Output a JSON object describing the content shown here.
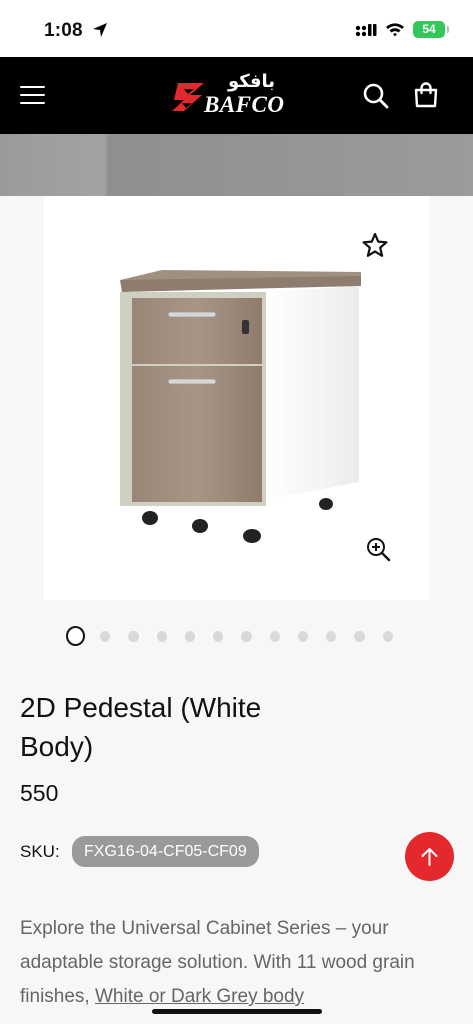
{
  "status": {
    "time": "1:08",
    "battery": "54"
  },
  "header": {
    "logo_arabic": "بافكو",
    "logo_text": "BAFCO"
  },
  "product": {
    "title": "2D Pedestal (White Body)",
    "price": "550",
    "sku_label": "SKU:",
    "sku_value": "FXG16-04-CF05-CF09",
    "image_count": 12,
    "active_image": 1
  },
  "description": {
    "text_before": "Explore the Universal Cabinet Series – your adaptable storage solution. With 11 wood grain finishes, ",
    "underlined": "White or Dark Grey body"
  },
  "colors": {
    "header_bg": "#000000",
    "accent_red": "#e3282e",
    "battery_green": "#34c759",
    "sku_badge_bg": "#9a9a9a"
  }
}
